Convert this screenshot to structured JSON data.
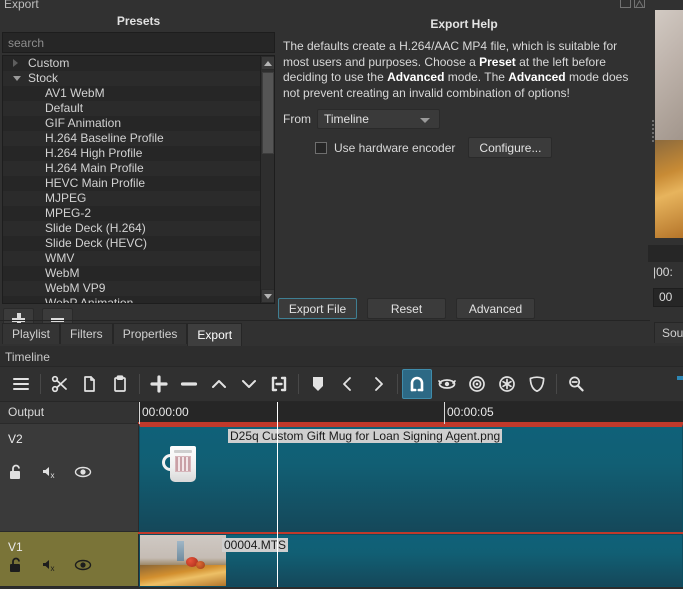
{
  "export_panel": {
    "title": "Export",
    "window_icons": [
      "float-icon",
      "close-icon"
    ],
    "presets": {
      "header": "Presets",
      "search_placeholder": "search",
      "tree": [
        {
          "label": "Custom",
          "type": "group",
          "expanded": false
        },
        {
          "label": "Stock",
          "type": "group",
          "expanded": true
        },
        {
          "label": "AV1 WebM",
          "type": "leaf"
        },
        {
          "label": "Default",
          "type": "leaf"
        },
        {
          "label": "GIF Animation",
          "type": "leaf"
        },
        {
          "label": "H.264 Baseline Profile",
          "type": "leaf"
        },
        {
          "label": "H.264 High Profile",
          "type": "leaf"
        },
        {
          "label": "H.264 Main Profile",
          "type": "leaf"
        },
        {
          "label": "HEVC Main Profile",
          "type": "leaf"
        },
        {
          "label": "MJPEG",
          "type": "leaf"
        },
        {
          "label": "MPEG-2",
          "type": "leaf"
        },
        {
          "label": "Slide Deck (H.264)",
          "type": "leaf"
        },
        {
          "label": "Slide Deck (HEVC)",
          "type": "leaf"
        },
        {
          "label": "WMV",
          "type": "leaf"
        },
        {
          "label": "WebM",
          "type": "leaf"
        },
        {
          "label": "WebM VP9",
          "type": "leaf"
        },
        {
          "label": "WebP Animation",
          "type": "leaf"
        }
      ],
      "add_button": "add-preset",
      "remove_button": "remove-preset"
    },
    "help": {
      "title": "Export Help",
      "paragraph_part1": "The defaults create a H.264/AAC MP4 file, which is suitable for most users and purposes. Choose a ",
      "bold1": "Preset",
      "paragraph_part2": " at the left before deciding to use the ",
      "bold2": "Advanced",
      "paragraph_part3": " mode. The ",
      "bold3": "Advanced",
      "paragraph_part4": " mode does not prevent creating an invalid combination of options!",
      "from_label": "From",
      "from_value": "Timeline",
      "hardware_encoder_label": "Use hardware encoder",
      "hardware_encoder_checked": false,
      "configure_button": "Configure..."
    },
    "actions": {
      "export_file": "Export File",
      "reset": "Reset",
      "advanced": "Advanced"
    },
    "tabs": [
      {
        "label": "Playlist",
        "active": false
      },
      {
        "label": "Filters",
        "active": false
      },
      {
        "label": "Properties",
        "active": false
      },
      {
        "label": "Export",
        "active": true
      }
    ]
  },
  "preview_strip": {
    "timecode_top": "|00:",
    "timecode_field": "00",
    "tab_label": "Sour"
  },
  "timeline": {
    "title": "Timeline",
    "toolbar": [
      {
        "name": "timeline-menu-icon",
        "glyph": "hamburger"
      },
      {
        "name": "cut-icon",
        "glyph": "scissors"
      },
      {
        "name": "copy-icon",
        "glyph": "copy"
      },
      {
        "name": "paste-icon",
        "glyph": "paste"
      },
      {
        "name": "append-icon",
        "glyph": "plus"
      },
      {
        "name": "ripple-delete-icon",
        "glyph": "minus"
      },
      {
        "name": "lift-icon",
        "glyph": "chevron-up"
      },
      {
        "name": "overwrite-icon",
        "glyph": "chevron-down"
      },
      {
        "name": "split-icon",
        "glyph": "split"
      },
      {
        "name": "marker-icon",
        "glyph": "marker"
      },
      {
        "name": "previous-marker-icon",
        "glyph": "chevron-left"
      },
      {
        "name": "next-marker-icon",
        "glyph": "chevron-right"
      },
      {
        "name": "snap-icon",
        "glyph": "magnet",
        "toggled": true
      },
      {
        "name": "scrub-while-dragging-icon",
        "glyph": "eye"
      },
      {
        "name": "ripple-icon",
        "glyph": "target"
      },
      {
        "name": "ripple-all-tracks-icon",
        "glyph": "asterisk-circle"
      },
      {
        "name": "ripple-markers-icon",
        "glyph": "shield"
      },
      {
        "name": "zoom-out-icon",
        "glyph": "zoom-out"
      }
    ],
    "output_label": "Output",
    "ruler_labels": [
      "00:00:00",
      "00:00:05"
    ],
    "tracks": [
      {
        "name": "V2",
        "clip_name": "D25q Custom Gift Mug for Loan Signing Agent.png",
        "selected": true,
        "icons": [
          "unlock-icon",
          "mute-icon",
          "hide-icon"
        ]
      },
      {
        "name": "V1",
        "clip_name": "00004.MTS",
        "selected": true,
        "icons": [
          "unlock-icon",
          "mute-icon",
          "hide-icon"
        ]
      }
    ]
  },
  "colors": {
    "panel_bg": "#313131",
    "accent": "#2d6985",
    "clip": "#0f6179",
    "selection": "#c0392b",
    "track_v1": "#7a7438"
  }
}
